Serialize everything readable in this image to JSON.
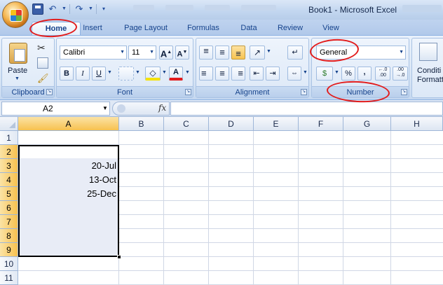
{
  "window": {
    "title": "Book1 - Microsoft Excel"
  },
  "quick_access": {
    "icons": [
      "save-icon",
      "undo-icon",
      "redo-icon",
      "customize-icon"
    ]
  },
  "tabs": [
    {
      "label": "Home",
      "active": true
    },
    {
      "label": "Insert"
    },
    {
      "label": "Page Layout"
    },
    {
      "label": "Formulas"
    },
    {
      "label": "Data"
    },
    {
      "label": "Review"
    },
    {
      "label": "View"
    }
  ],
  "ribbon": {
    "clipboard": {
      "label": "Clipboard",
      "paste_label": "Paste"
    },
    "font": {
      "label": "Font",
      "font_name": "Calibri",
      "font_size": "11",
      "bold": "B",
      "italic": "I",
      "underline": "U",
      "grow": "A",
      "shrink": "A",
      "font_color": "A"
    },
    "alignment": {
      "label": "Alignment"
    },
    "number": {
      "label": "Number",
      "format": "General",
      "percent": "%",
      "comma": ",",
      "inc_decimal": "←.0\n.00",
      "dec_decimal": ".00\n→.0"
    },
    "styles": {
      "label": "Conditi Formatt"
    }
  },
  "formula_bar": {
    "name_box": "A2",
    "fx": "fx",
    "value": ""
  },
  "grid": {
    "columns": [
      "A",
      "B",
      "C",
      "D",
      "E",
      "F",
      "G",
      "H"
    ],
    "selected_column": "A",
    "rows": [
      "1",
      "2",
      "3",
      "4",
      "5",
      "6",
      "7",
      "8",
      "9",
      "10",
      "11"
    ],
    "selected_rows": [
      "2",
      "3",
      "4",
      "5",
      "6",
      "7",
      "8",
      "9"
    ],
    "cells": {
      "A3": "20-Jul",
      "A4": "13-Oct",
      "A5": "25-Dec"
    }
  },
  "annotations": {
    "color": "#e21c1c",
    "circled": [
      "Home",
      "General",
      "Number"
    ]
  },
  "colors": {
    "ribbon": "#d5e3f4",
    "selection_header": "#f7c14f",
    "selection_fill": "#e8ecf6"
  }
}
